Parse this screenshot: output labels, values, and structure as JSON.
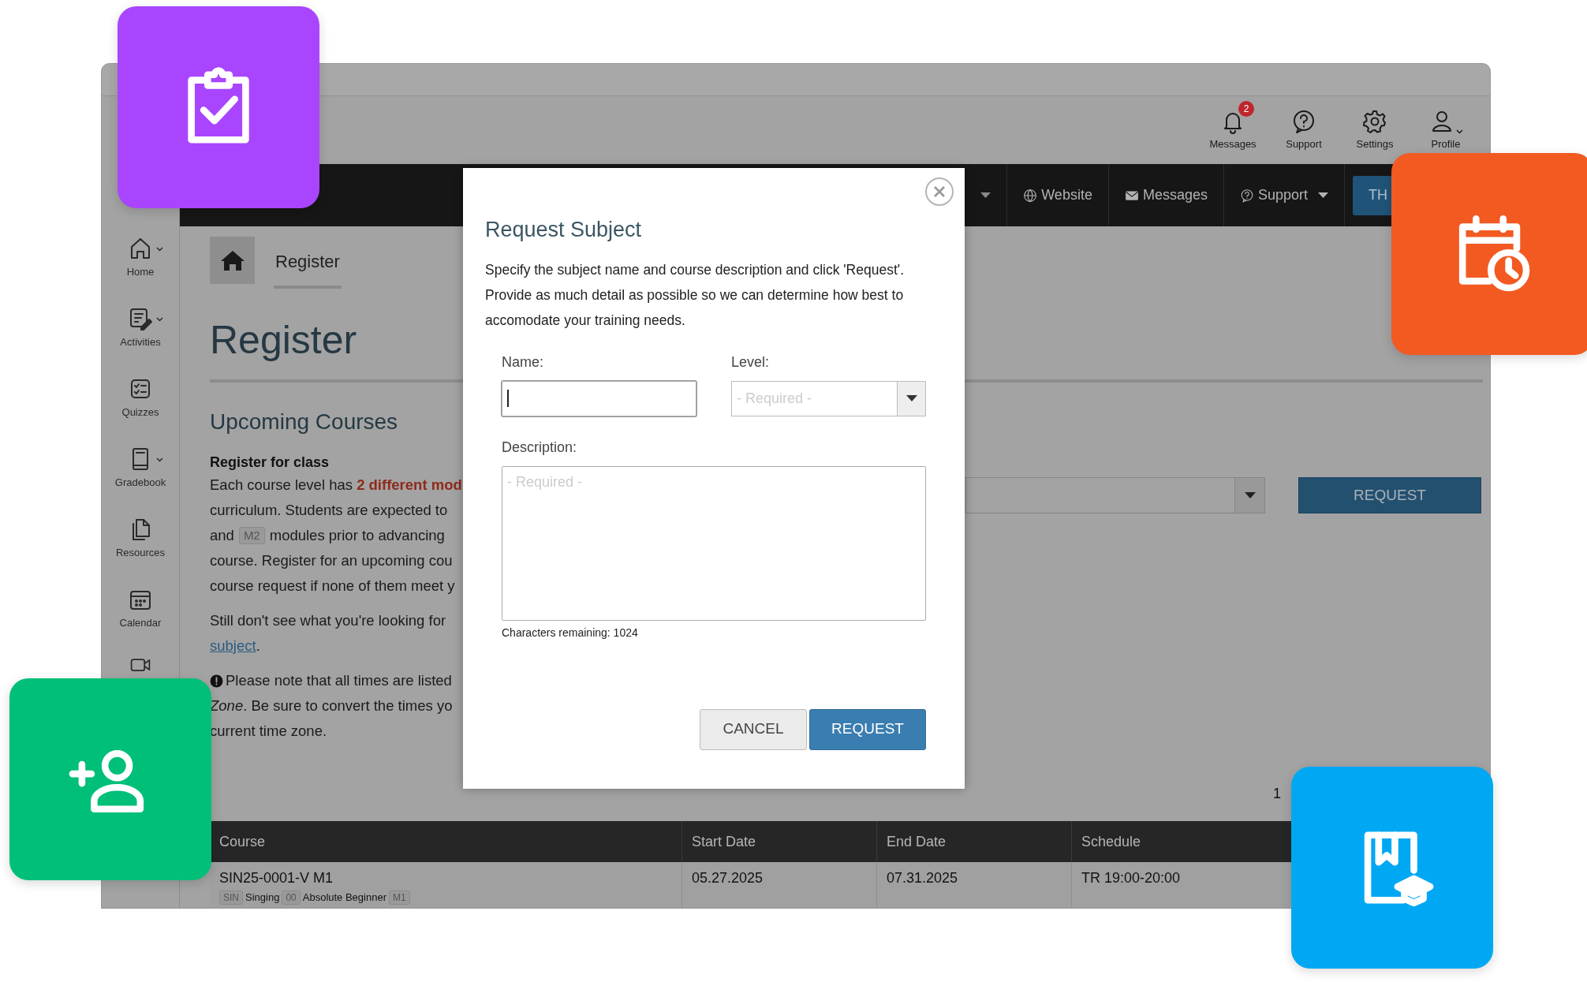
{
  "top_bar": {
    "items": [
      {
        "kind": "bell",
        "label": "Messages",
        "badge": "2",
        "has_menu": false
      },
      {
        "kind": "help",
        "label": "Support",
        "has_menu": false
      },
      {
        "kind": "gear",
        "label": "Settings",
        "has_menu": false
      },
      {
        "kind": "user",
        "label": "Profile",
        "has_menu": true
      }
    ]
  },
  "nav_bar": {
    "items": [
      {
        "kind": "caret"
      },
      {
        "kind": "link",
        "label": "Website",
        "has_menu": false
      },
      {
        "kind": "link",
        "label": "Messages",
        "has_menu": false
      },
      {
        "kind": "link",
        "label": "Support",
        "has_menu": true
      },
      {
        "kind": "button",
        "label": "TH"
      }
    ]
  },
  "sidebar": {
    "items": [
      {
        "label": "Home",
        "has_menu": true
      },
      {
        "label": "Activities",
        "has_menu": true
      },
      {
        "label": "Quizzes",
        "has_menu": false
      },
      {
        "label": "Gradebook",
        "has_menu": true
      },
      {
        "label": "Resources",
        "has_menu": false
      },
      {
        "label": "Calendar",
        "has_menu": false
      },
      {
        "has_menu": false
      }
    ]
  },
  "breadcrumb": {
    "label": "Register"
  },
  "page_title": "Register",
  "section_title": "Upcoming Courses",
  "register_block": {
    "heading": "Register for class",
    "lines": [
      [
        {
          "kind": "text",
          "text": "Each course level has **2 different mod**"
        }
      ],
      [
        {
          "kind": "text",
          "text": "curriculum. Students are expected to"
        }
      ],
      [
        {
          "kind": "text",
          "text": "and"
        },
        {
          "kind": "tag",
          "text": "M2"
        },
        {
          "kind": "text",
          "text": "modules prior to advancing"
        }
      ],
      [
        {
          "kind": "text",
          "text": "course. Register for an upcoming cou"
        }
      ],
      [
        {
          "kind": "text",
          "text": "course request if none of them meet y"
        }
      ]
    ]
  },
  "help_block": {
    "lines": [
      [
        {
          "kind": "text",
          "text": "Still don't see what you're looking for"
        }
      ],
      [
        {
          "kind": "link",
          "text": "subject"
        },
        {
          "kind": "text",
          "text": "."
        }
      ]
    ]
  },
  "note_block": {
    "lines": [
      [
        {
          "kind": "alert"
        },
        {
          "kind": "text",
          "text": "Please note that all times are listed"
        }
      ],
      [
        {
          "kind": "text",
          "text": "*Zone*. Be sure to convert the times yo"
        }
      ],
      [
        {
          "kind": "text",
          "text": "current time zone."
        }
      ]
    ]
  },
  "request_button": "REQUEST",
  "pagination": "1",
  "table": {
    "columns": [
      "Course",
      "Start Date",
      "End Date",
      "Schedule"
    ],
    "rows": [
      {
        "course": "SIN25-0001-V M1",
        "tags": [
          {
            "kind": "tag",
            "text": "SIN"
          },
          {
            "kind": "text",
            "text": "Singing"
          },
          {
            "kind": "tag",
            "text": "00"
          },
          {
            "kind": "text",
            "text": "Absolute Beginner"
          },
          {
            "kind": "tag",
            "text": "M1"
          }
        ],
        "start": "05.27.2025",
        "end": "07.31.2025",
        "schedule": "TR 19:00-20:00"
      }
    ]
  },
  "modal": {
    "title": "Request Subject",
    "text": "Specify the subject name and course description and click 'Request'. Provide as much detail as possible so we can determine how best to accomodate your training needs.",
    "name_field": {
      "label": "Name:",
      "focused": true
    },
    "level_field": {
      "label": "Level:",
      "placeholder": "- Required -"
    },
    "description_field": {
      "label": "Description:",
      "placeholder": "- Required -"
    },
    "char_count": "Characters remaining: 1024",
    "buttons": [
      {
        "kind": "secondary",
        "label": "CANCEL"
      },
      {
        "kind": "primary",
        "label": "REQUEST"
      }
    ]
  },
  "tiles": [
    {
      "kind": "clipboard",
      "color": "#a945ff"
    },
    {
      "kind": "calendar",
      "color": "#f25a22"
    },
    {
      "kind": "add_user",
      "color": "#00bf78"
    },
    {
      "kind": "book",
      "color": "#00a8f3"
    }
  ]
}
